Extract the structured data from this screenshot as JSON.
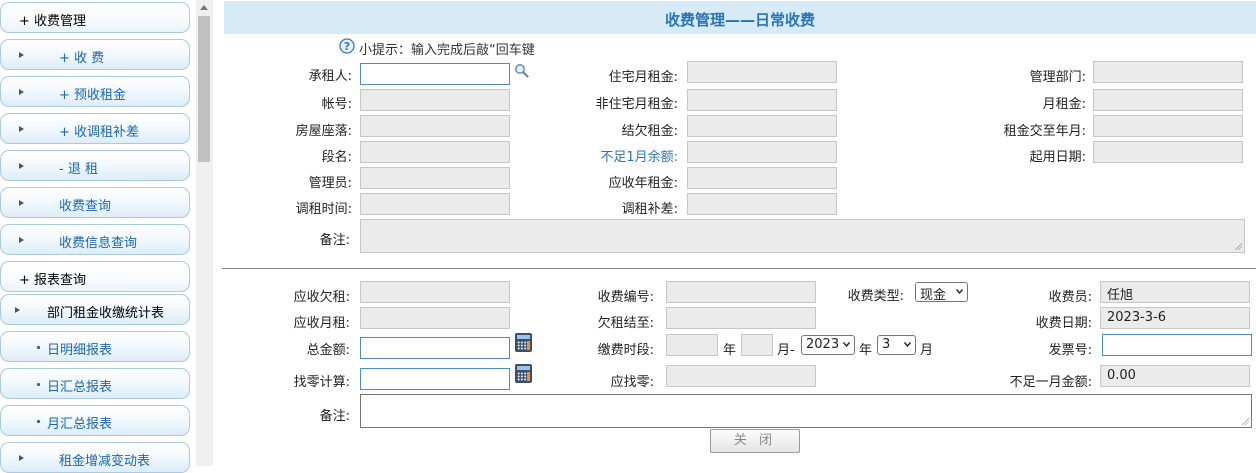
{
  "sidebar": {
    "items": [
      {
        "label": "+ 收费管理"
      },
      {
        "label": "+ 收  费"
      },
      {
        "label": "+ 预收租金"
      },
      {
        "label": "+ 收调租补差"
      },
      {
        "label": "- 退  租"
      },
      {
        "label": "收费查询"
      },
      {
        "label": "收费信息查询"
      },
      {
        "label": "+ 报表查询"
      },
      {
        "label": "部门租金收缴统计表"
      },
      {
        "label": "日明细报表"
      },
      {
        "label": "日汇总报表"
      },
      {
        "label": "月汇总报表"
      },
      {
        "label": "租金增减变动表"
      }
    ]
  },
  "header": {
    "title": "收费管理——日常收费"
  },
  "hint": {
    "text": "小提示：输入完成后敲“回车键"
  },
  "tenant_form": {
    "tenant_label": "承租人:",
    "tenant_value": "",
    "account_label": "帐号:",
    "address_label": "房屋座落:",
    "section_label": "段名:",
    "manager_label": "管理员:",
    "adjust_time_label": "调租时间:",
    "residential_rent_label": "住宅月租金:",
    "nonresidential_rent_label": "非住宅月租金:",
    "owed_rent_label": "结欠租金:",
    "balance_label": "不足1月余额:",
    "annual_rent_label": "应收年租金:",
    "adjust_diff_label": "调租补差:",
    "department_label": "管理部门:",
    "monthly_rent_label": "月租金:",
    "paid_until_label": "租金交至年月:",
    "start_date_label": "起用日期:",
    "remark_label": "备注:"
  },
  "payment_form": {
    "owed_label": "应收欠租:",
    "monthly_due_label": "应收月租:",
    "total_label": "总金额:",
    "change_calc_label": "找零计算:",
    "fee_no_label": "收费编号:",
    "owed_until_label": "欠租结至:",
    "period_label": "缴费时段:",
    "year_unit": "年",
    "month_to": "月-",
    "year_unit2": "年",
    "month_unit": "月",
    "year_select": "2023",
    "month_select": "3",
    "change_due_label": "应找零:",
    "fee_type_label": "收费类型:",
    "fee_type_value": "现金",
    "cashier_label": "收费员:",
    "cashier_value": "任旭",
    "fee_date_label": "收费日期:",
    "fee_date_value": "2023-3-6",
    "invoice_label": "发票号:",
    "invoice_value": "",
    "shortfall_label": "不足一月金额:",
    "shortfall_value": "0.00",
    "remark_label": "备注:",
    "close_label": "关 闭"
  }
}
